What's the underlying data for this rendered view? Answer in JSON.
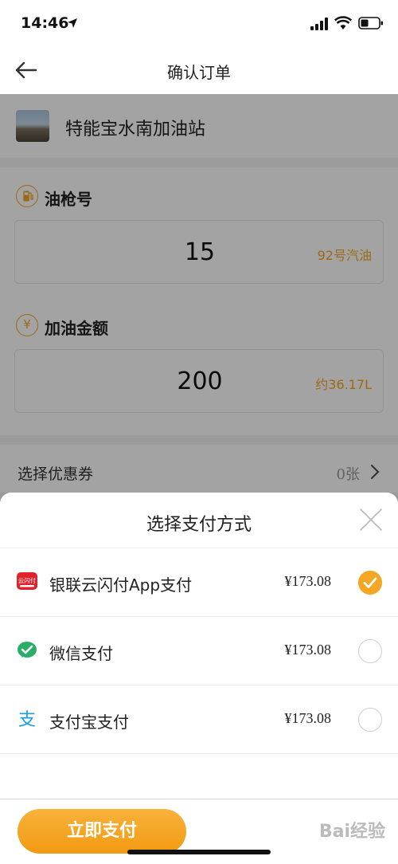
{
  "status_bar": {
    "time": "14:46"
  },
  "nav": {
    "title": "确认订单"
  },
  "station": {
    "name": "特能宝水南加油站"
  },
  "nozzle": {
    "icon_name": "fuel-pump-icon",
    "label": "油枪号",
    "value": "15",
    "fuel_type": "92号汽油"
  },
  "amount": {
    "icon_glyph": "¥",
    "label": "加油金额",
    "value": "200",
    "volume": "约36.17L"
  },
  "coupon": {
    "label": "选择优惠券",
    "count": "0张"
  },
  "payment_sheet": {
    "title": "选择支付方式",
    "options": [
      {
        "label": "银联云闪付App支付",
        "amount": "¥173.08",
        "selected": true,
        "icon_name": "unionpay-quickpass-icon",
        "icon_text": "云闪付"
      },
      {
        "label": "微信支付",
        "amount": "¥173.08",
        "selected": false,
        "icon_name": "wechat-pay-icon"
      },
      {
        "label": "支付宝支付",
        "amount": "¥173.08",
        "selected": false,
        "icon_name": "alipay-icon",
        "icon_text": "支"
      }
    ]
  },
  "action": {
    "pay_now_label": "立即支付"
  },
  "watermark": {
    "text": "Bai经验"
  },
  "colors": {
    "accent": "#f5a623",
    "wechat_green": "#2aae67",
    "alipay_blue": "#1a9de0",
    "unionpay_red": "#e0222a"
  }
}
